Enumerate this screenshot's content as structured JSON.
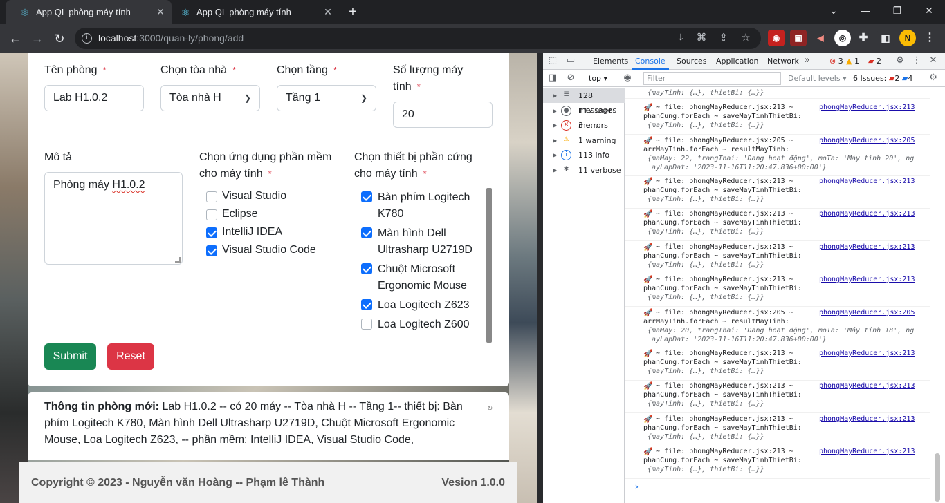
{
  "browser": {
    "tabs": [
      {
        "title": "App QL phòng máy tính",
        "active": true
      },
      {
        "title": "App QL phòng máy tính",
        "active": false
      }
    ],
    "new_tab": "+",
    "url_host": "localhost",
    "url_path": ":3000/quan-ly/phong/add",
    "extensions": [
      "N"
    ],
    "accent": "#35363a"
  },
  "form": {
    "ten_phong_label": "Tên phòng",
    "ten_phong_value": "Lab H1.0.2",
    "toa_nha_label": "Chọn tòa nhà",
    "toa_nha_value": "Tòa nhà H",
    "tang_label": "Chọn tầng",
    "tang_value": "Tầng 1",
    "so_luong_label_1": "Số lượng máy",
    "so_luong_label_2": "tính",
    "so_luong_value": "20",
    "mo_ta_label": "Mô tả",
    "mo_ta_value_a": "Phòng máy ",
    "mo_ta_value_b": "H1.0.2",
    "phan_mem_label_1": "Chọn ứng dụng phần mềm",
    "phan_mem_label_2": "cho máy tính",
    "phan_mem": [
      {
        "label": "Visual Studio",
        "checked": false
      },
      {
        "label": "Eclipse",
        "checked": false
      },
      {
        "label": "IntelliJ IDEA",
        "checked": true
      },
      {
        "label": "Visual Studio Code",
        "checked": true
      }
    ],
    "thiet_bi_label_1": "Chọn thiết bị phần cứng",
    "thiet_bi_label_2": "cho máy tính",
    "thiet_bi": [
      {
        "line1": "Bàn phím Logitech",
        "line2": "K780",
        "checked": true
      },
      {
        "line1": "Màn hình Dell",
        "line2": "Ultrasharp U2719D",
        "checked": true
      },
      {
        "line1": "Chuột Microsoft",
        "line2": "Ergonomic Mouse",
        "checked": true
      },
      {
        "line1": "Loa Logitech Z623",
        "line2": "",
        "checked": true
      },
      {
        "line1": "Loa Logitech Z600",
        "line2": "",
        "checked": false
      }
    ],
    "required_mark": "*",
    "submit_label": "Submit",
    "reset_label": "Reset",
    "colors": {
      "submit": "#198754",
      "reset": "#dc3545",
      "checkbox": "#0d6efd"
    }
  },
  "info": {
    "title": "Thông tin phòng mới:",
    "text": " Lab H1.0.2 -- có 20 máy -- Tòa nhà H -- Tầng 1-- thiết bị: Bàn phím Logitech K780, Màn hình Dell Ultrasharp U2719D, Chuột Microsoft Ergonomic Mouse, Loa Logitech Z623, -- phần mềm: IntelliJ IDEA, Visual Studio Code,"
  },
  "footer": {
    "copyright": "Copyright © 2023 - Nguyễn văn Hoàng -- Phạm lê Thành",
    "version": "Vesion 1.0.0"
  },
  "devtools": {
    "tabs": [
      "Elements",
      "Console",
      "Sources",
      "Application",
      "Network"
    ],
    "active_tab": "Console",
    "context": "top",
    "filter_placeholder": "Filter",
    "levels": "Default levels",
    "issues_label": "6 Issues:",
    "issues_errors": "2",
    "issues_info": "4",
    "badge_errors": "3",
    "badge_warnings": "1",
    "badge_messages": "2",
    "sidebar": [
      {
        "label": "128 messages",
        "icon": "list-icon"
      },
      {
        "label": "117 user me...",
        "icon": "user-icon"
      },
      {
        "label": "3 errors",
        "icon": "error-icon"
      },
      {
        "label": "1 warning",
        "icon": "warning-icon"
      },
      {
        "label": "113 info",
        "icon": "info-icon"
      },
      {
        "label": "11 verbose",
        "icon": "bug-icon"
      }
    ],
    "log_src_213": "phongMayReducer.jsx:213",
    "log_src_205": "phongMayReducer.jsx:205",
    "log_213_line1": " ~ file: phongMayReducer.jsx:213 ~",
    "log_213_line2": "phanCung.forEach ~ saveMayTinhThietBi:",
    "log_213_line3": "{mayTinh: {…}, thietBi: {…}}",
    "log_205_line1": " ~ file: phongMayReducer.jsx:205 ~",
    "log_205_line2": "arrMayTinh.forEach ~ resultMayTinh:",
    "log_205_a_line3": "{maMay: 22, trangThai: 'Đang hoạt động', moTa: 'Máy tính 20', ng",
    "log_205_b_line3": "{maMay: 20, trangThai: 'Đang hoạt động', moTa: 'Máy tính 18', ng",
    "log_205_line4": "ayLapDat: '2023-11-16T11:20:47.836+00:00'}",
    "top_partial": "{mayTinh: {…}, thietBi: {…}}",
    "prompt": "›"
  }
}
